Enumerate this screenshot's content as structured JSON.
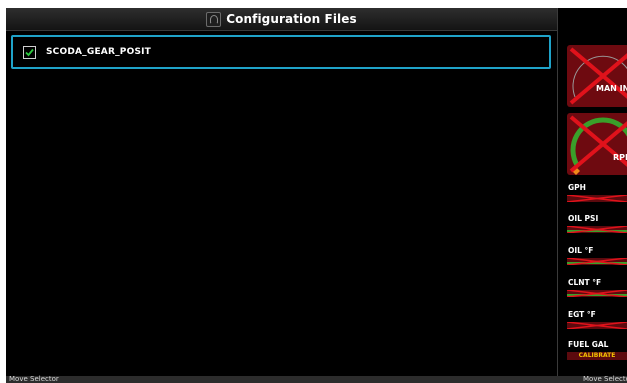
{
  "title_bar": {
    "title": "Configuration Files",
    "icon": "configuration-icon"
  },
  "file_list": [
    {
      "name": "SCODA_GEAR_POSIT",
      "checked": true
    }
  ],
  "engine_strip": {
    "dials": [
      {
        "label": "MAN IN",
        "status": "failed"
      },
      {
        "label": "RPM",
        "status": "failed"
      }
    ],
    "gauges": [
      {
        "label": "GPH",
        "status": "failed"
      },
      {
        "label": "OIL PSI",
        "status": "failed"
      },
      {
        "label": "OIL °F",
        "status": "failed"
      },
      {
        "label": "CLNT °F",
        "status": "failed"
      },
      {
        "label": "EGT °F",
        "status": "failed"
      },
      {
        "label": "FUEL GAL",
        "status": "calibrate",
        "badge": "CALIBRATE"
      }
    ]
  },
  "status_bar": {
    "left_text": "Move Selector",
    "right_text": "Move Selector"
  },
  "colors": {
    "selection_border": "#1fa3c9",
    "check_mark": "#2ecc40",
    "failure_fill": "#6e0a10",
    "failure_x": "#e0121b",
    "calibrate_text": "#f2c200",
    "arc_green": "#3aa02a"
  }
}
